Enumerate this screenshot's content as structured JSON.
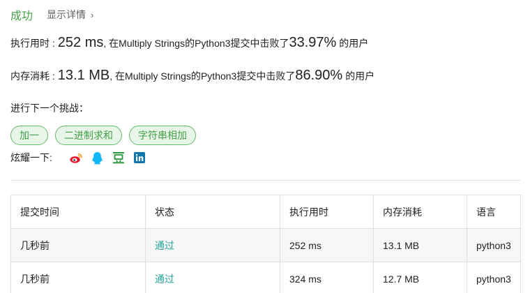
{
  "header": {
    "status": "成功",
    "details_label": "显示详情",
    "details_chevron": "›"
  },
  "runtime": {
    "label": "执行用时 :",
    "value": "252 ms",
    "prefix": ", 在Multiply Strings的Python3提交中击败了",
    "percent": "33.97%",
    "suffix": "的用户"
  },
  "memory": {
    "label": "内存消耗 :",
    "value": "13.1 MB",
    "prefix": ", 在Multiply Strings的Python3提交中击败了",
    "percent": "86.90%",
    "suffix": "的用户"
  },
  "next": {
    "title": "进行下一个挑战：",
    "tags": [
      "加一",
      "二进制求和",
      "字符串相加"
    ]
  },
  "share": {
    "label": "炫耀一下:",
    "icons": [
      "weibo-icon",
      "qq-icon",
      "douban-icon",
      "linkedin-icon"
    ],
    "colors": {
      "weibo": "#e6162d",
      "qq": "#12b7f5",
      "douban": "#2e963d",
      "linkedin": "#0e76a8"
    }
  },
  "table": {
    "headers": [
      "提交时间",
      "状态",
      "执行用时",
      "内存消耗",
      "语言"
    ],
    "rows": [
      [
        "几秒前",
        "通过",
        "252 ms",
        "13.1 MB",
        "python3"
      ],
      [
        "几秒前",
        "通过",
        "324 ms",
        "12.7 MB",
        "python3"
      ]
    ]
  },
  "colors": {
    "accent_green": "#43a047",
    "status_teal": "#26a69a",
    "tag_bg": "#e8f5e9",
    "tag_border": "#66bb6a"
  }
}
